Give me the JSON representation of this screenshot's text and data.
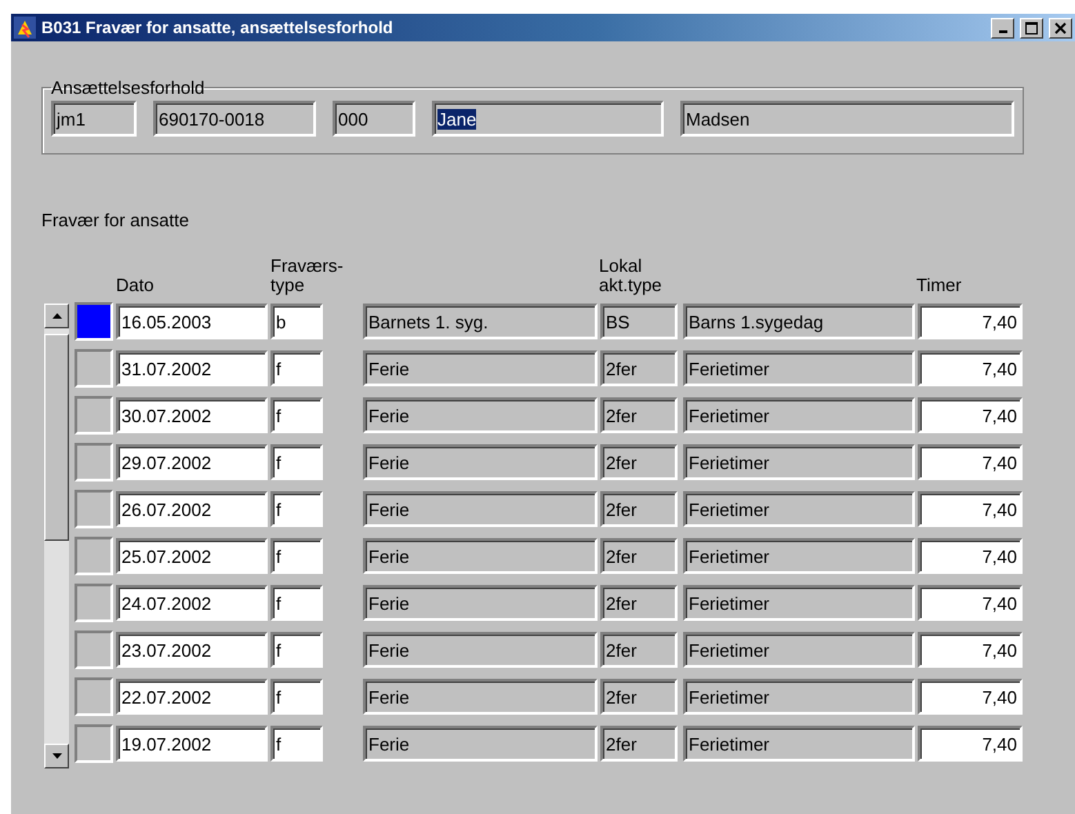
{
  "window": {
    "title": "B031 Fravær for ansatte, ansættelsesforhold"
  },
  "employment": {
    "legend": "Ansættelsesforhold",
    "fields": [
      {
        "value": "jm1",
        "highlighted": false
      },
      {
        "value": "690170-0018",
        "highlighted": false
      },
      {
        "value": "000",
        "highlighted": false
      },
      {
        "value": "Jane",
        "highlighted": true
      },
      {
        "value": "Madsen",
        "highlighted": false
      }
    ]
  },
  "absence": {
    "title": "Fravær for ansatte",
    "columns": {
      "date": "Dato",
      "type": "Fraværs-\ntype",
      "local_type": "Lokal\nakt.type",
      "hours": "Timer"
    },
    "rows": [
      {
        "selected": true,
        "date": "16.05.2003",
        "type": "b",
        "type_name": "Barnets 1. syg.",
        "local_type": "BS",
        "local_name": "Barns 1.sygedag",
        "hours": "7,40"
      },
      {
        "selected": false,
        "date": "31.07.2002",
        "type": "f",
        "type_name": "Ferie",
        "local_type": "2fer",
        "local_name": "Ferietimer",
        "hours": "7,40"
      },
      {
        "selected": false,
        "date": "30.07.2002",
        "type": "f",
        "type_name": "Ferie",
        "local_type": "2fer",
        "local_name": "Ferietimer",
        "hours": "7,40"
      },
      {
        "selected": false,
        "date": "29.07.2002",
        "type": "f",
        "type_name": "Ferie",
        "local_type": "2fer",
        "local_name": "Ferietimer",
        "hours": "7,40"
      },
      {
        "selected": false,
        "date": "26.07.2002",
        "type": "f",
        "type_name": "Ferie",
        "local_type": "2fer",
        "local_name": "Ferietimer",
        "hours": "7,40"
      },
      {
        "selected": false,
        "date": "25.07.2002",
        "type": "f",
        "type_name": "Ferie",
        "local_type": "2fer",
        "local_name": "Ferietimer",
        "hours": "7,40"
      },
      {
        "selected": false,
        "date": "24.07.2002",
        "type": "f",
        "type_name": "Ferie",
        "local_type": "2fer",
        "local_name": "Ferietimer",
        "hours": "7,40"
      },
      {
        "selected": false,
        "date": "23.07.2002",
        "type": "f",
        "type_name": "Ferie",
        "local_type": "2fer",
        "local_name": "Ferietimer",
        "hours": "7,40"
      },
      {
        "selected": false,
        "date": "22.07.2002",
        "type": "f",
        "type_name": "Ferie",
        "local_type": "2fer",
        "local_name": "Ferietimer",
        "hours": "7,40"
      },
      {
        "selected": false,
        "date": "19.07.2002",
        "type": "f",
        "type_name": "Ferie",
        "local_type": "2fer",
        "local_name": "Ferietimer",
        "hours": "7,40"
      }
    ]
  }
}
